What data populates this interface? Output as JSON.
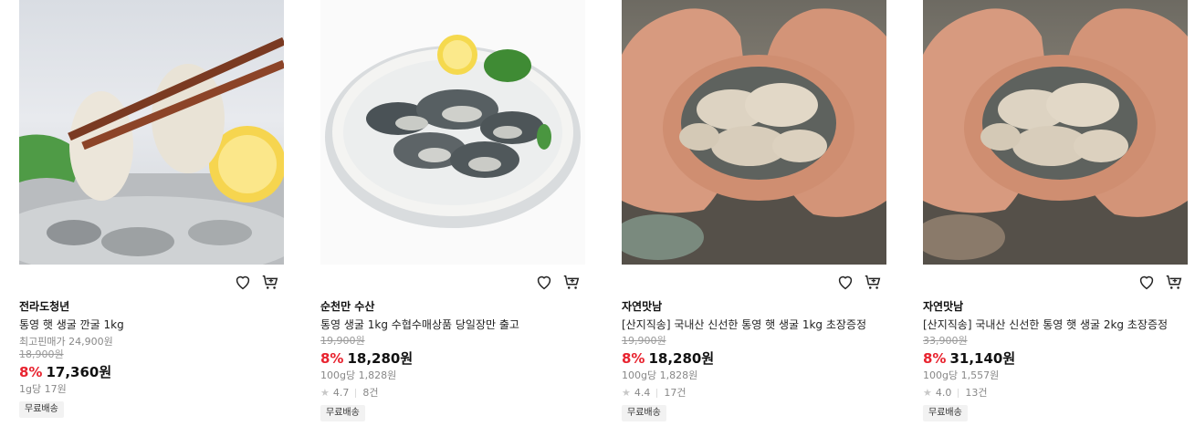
{
  "products": [
    {
      "brand": "전라도청년",
      "name": "통영 햇 생굴 깐굴 1kg",
      "lowest_price_label": "최고핀매가 24,900원",
      "original_price": "18,900원",
      "discount": "8%",
      "price": "17,360원",
      "unit_price": "1g당 17원",
      "badge": "무료배송"
    },
    {
      "brand": "순천만 수산",
      "name": "통영 생굴 1kg 수협수매상품 당일장만 출고",
      "original_price": "19,900원",
      "discount": "8%",
      "price": "18,280원",
      "unit_price": "100g당 1,828원",
      "rating": "4.7",
      "reviews": "8건",
      "badge": "무료배송"
    },
    {
      "brand": "자연맛남",
      "name": "[산지직송] 국내산 신선한 통영 햇 생굴 1kg 초장증정",
      "original_price": "19,900원",
      "discount": "8%",
      "price": "18,280원",
      "unit_price": "100g당 1,828원",
      "rating": "4.4",
      "reviews": "17건",
      "badge": "무료배송"
    },
    {
      "brand": "자연맛남",
      "name": "[산지직송] 국내산 신선한 통영 햇 생굴 2kg 초장증정",
      "original_price": "33,900원",
      "discount": "8%",
      "price": "31,140원",
      "unit_price": "100g당 1,557원",
      "rating": "4.0",
      "reviews": "13건",
      "badge": "무료배송"
    }
  ],
  "icons": {
    "wishlist": "heart-icon",
    "cart": "cart-icon",
    "rating": "star-icon"
  },
  "colors": {
    "discount": "#e8232f"
  }
}
